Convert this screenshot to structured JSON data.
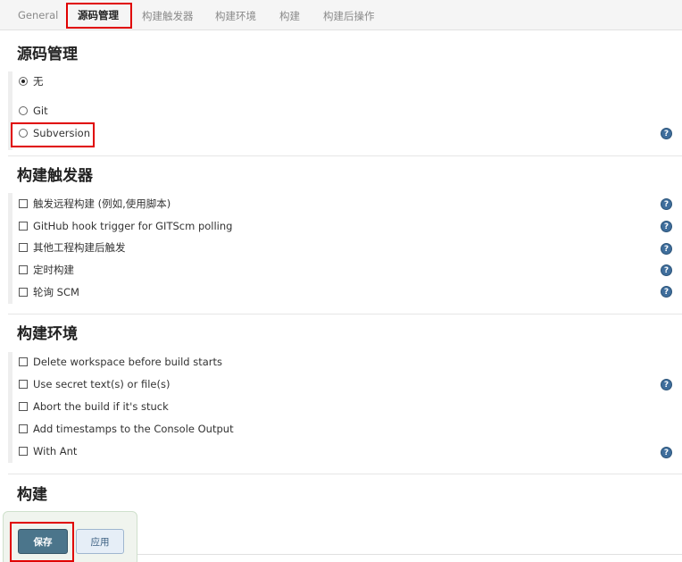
{
  "tabs": {
    "general": "General",
    "scm": "源码管理",
    "triggers": "构建触发器",
    "env": "构建环境",
    "build": "构建",
    "post": "构建后操作"
  },
  "scm": {
    "title": "源码管理",
    "options": [
      "无",
      "Git",
      "Subversion"
    ],
    "selected": "无"
  },
  "triggers": {
    "title": "构建触发器",
    "options": [
      "触发远程构建 (例如,使用脚本)",
      "GitHub hook trigger for GITScm polling",
      "其他工程构建后触发",
      "定时构建",
      "轮询 SCM"
    ]
  },
  "env": {
    "title": "构建环境",
    "options": [
      "Delete workspace before build starts",
      "Use secret text(s) or file(s)",
      "Abort the build if it's stuck",
      "Add timestamps to the Console Output",
      "With Ant"
    ]
  },
  "build": {
    "title": "构建"
  },
  "footer": {
    "save": "保存",
    "apply": "应用"
  },
  "help_glyph": "?",
  "colors": {
    "highlight": "#e00000",
    "save_button": "#4b758b",
    "help_icon": "#3f6e9c"
  }
}
